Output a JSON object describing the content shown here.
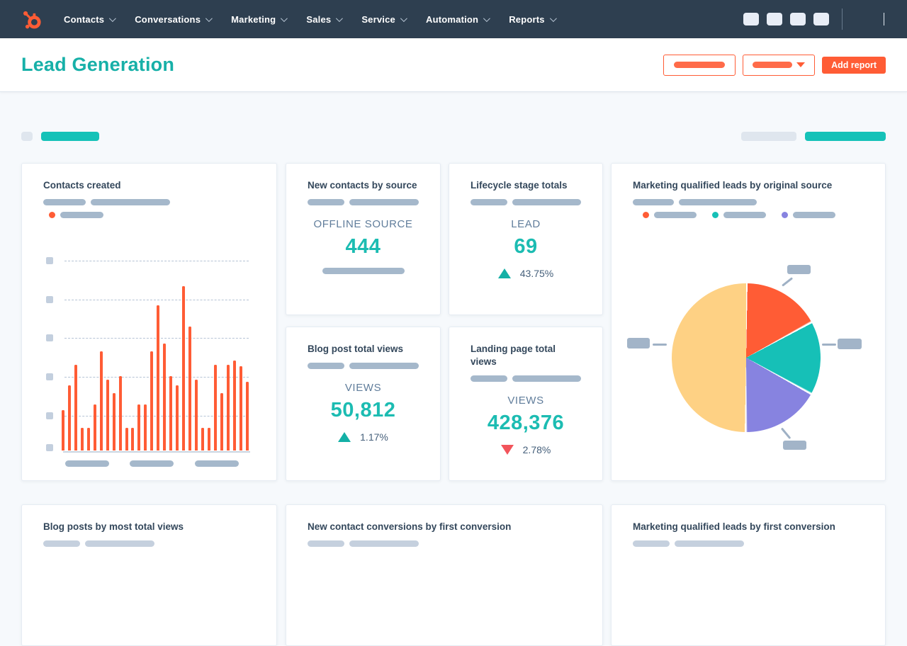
{
  "nav": {
    "items": [
      "Contacts",
      "Conversations",
      "Marketing",
      "Sales",
      "Service",
      "Automation",
      "Reports"
    ]
  },
  "header": {
    "title": "Lead Generation",
    "add_report_label": "Add report"
  },
  "cards": {
    "contacts_created": {
      "title": "Contacts created"
    },
    "new_contacts_by_source": {
      "title": "New contacts by source",
      "metric_label": "OFFLINE SOURCE",
      "value": "444"
    },
    "lifecycle_stage_totals": {
      "title": "Lifecycle stage totals",
      "metric_label": "LEAD",
      "value": "69",
      "delta": "43.75%",
      "delta_direction": "up"
    },
    "blog_post_total_views": {
      "title": "Blog post total views",
      "metric_label": "VIEWS",
      "value": "50,812",
      "delta": "1.17%",
      "delta_direction": "up"
    },
    "landing_page_total_views": {
      "title": "Landing page total views",
      "metric_label": "VIEWS",
      "value": "428,376",
      "delta": "2.78%",
      "delta_direction": "down"
    },
    "mql_by_original_source": {
      "title": "Marketing qualified leads by original source"
    },
    "blog_posts_by_most_total_views": {
      "title": "Blog posts by most total views"
    },
    "new_contact_conversions_by_first_conversion": {
      "title": "New contact conversions by first conversion"
    },
    "mql_by_first_conversion": {
      "title": "Marketing qualified leads by first conversion"
    }
  },
  "chart_data": [
    {
      "type": "bar",
      "title": "Contacts created",
      "values": [
        21,
        34,
        45,
        12,
        12,
        24,
        52,
        37,
        30,
        39,
        12,
        12,
        24,
        24,
        52,
        76,
        56,
        39,
        34,
        86,
        65,
        37,
        12,
        12,
        45,
        30,
        45,
        47,
        44,
        36
      ],
      "ylim": [
        0,
        100
      ],
      "color": "#ff5c35",
      "grid": true,
      "tick_labels_visible": false,
      "legend": "single orange series (label shown as placeholder pill)"
    },
    {
      "type": "pie",
      "title": "Marketing qualified leads by original source",
      "slices": [
        {
          "label": "slice-1",
          "value": 17,
          "color": "#ff5c35"
        },
        {
          "label": "slice-2",
          "value": 16,
          "color": "#16c0b7"
        },
        {
          "label": "slice-3",
          "value": 17,
          "color": "#8783e0"
        },
        {
          "label": "slice-4",
          "value": 50,
          "color": "#fed184"
        }
      ],
      "start_angle_deg": 0,
      "legend_position": "top",
      "labels_visible": false
    }
  ],
  "colors": {
    "nav_bg": "#2e3f50",
    "accent_orange": "#ff5c35",
    "headline_teal": "#17b0a8",
    "number_teal": "#1cbcb2",
    "filter_teal": "#16c2b8",
    "title_text": "#33475b",
    "muted_label": "#607d9b",
    "delta_up": "#14b0a6",
    "delta_down": "#f2545b",
    "pie_yellow": "#fed184",
    "pie_purple": "#8783e0",
    "placeholder_dark": "#a5b8cb",
    "placeholder_light": "#dfe6ee"
  }
}
